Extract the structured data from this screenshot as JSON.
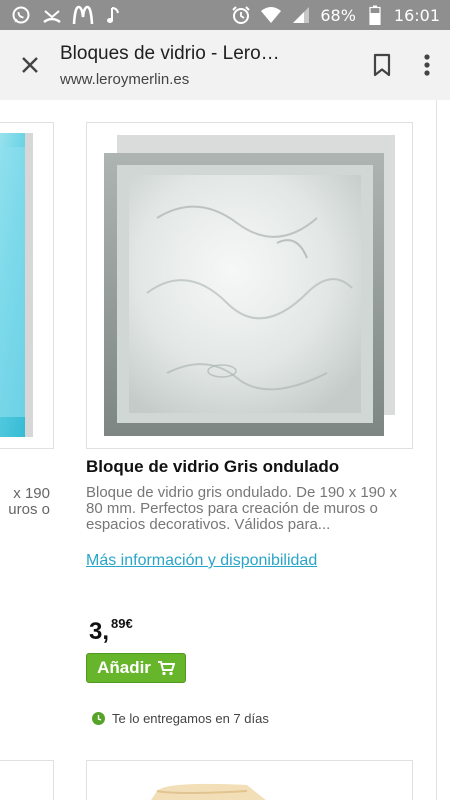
{
  "status_bar": {
    "battery": "68%",
    "time": "16:01"
  },
  "toolbar": {
    "title": "Bloques de vidrio - Lero…",
    "url": "www.leroymerlin.es"
  },
  "previous_product": {
    "desc_lines": [
      "x 190",
      "uros o"
    ]
  },
  "product": {
    "title": "Bloque de vidrio Gris ondulado",
    "description": "Bloque de vidrio gris ondulado. De 190 x 190 x 80 mm. Perfectos para creación de muros o espacios decorativos. Válidos para...",
    "more_info_link": "Más información y disponibilidad",
    "price_integer": "3,",
    "price_decimal": "89€",
    "add_button_label": "Añadir",
    "delivery_text": "Te lo entregamos en 7 días"
  },
  "colors": {
    "status_bar_bg": "#8f8f8f",
    "toolbar_bg": "#f2f2f2",
    "link": "#2aa5c9",
    "add_button": "#67b52b",
    "delivery_dot": "#56a32a"
  }
}
